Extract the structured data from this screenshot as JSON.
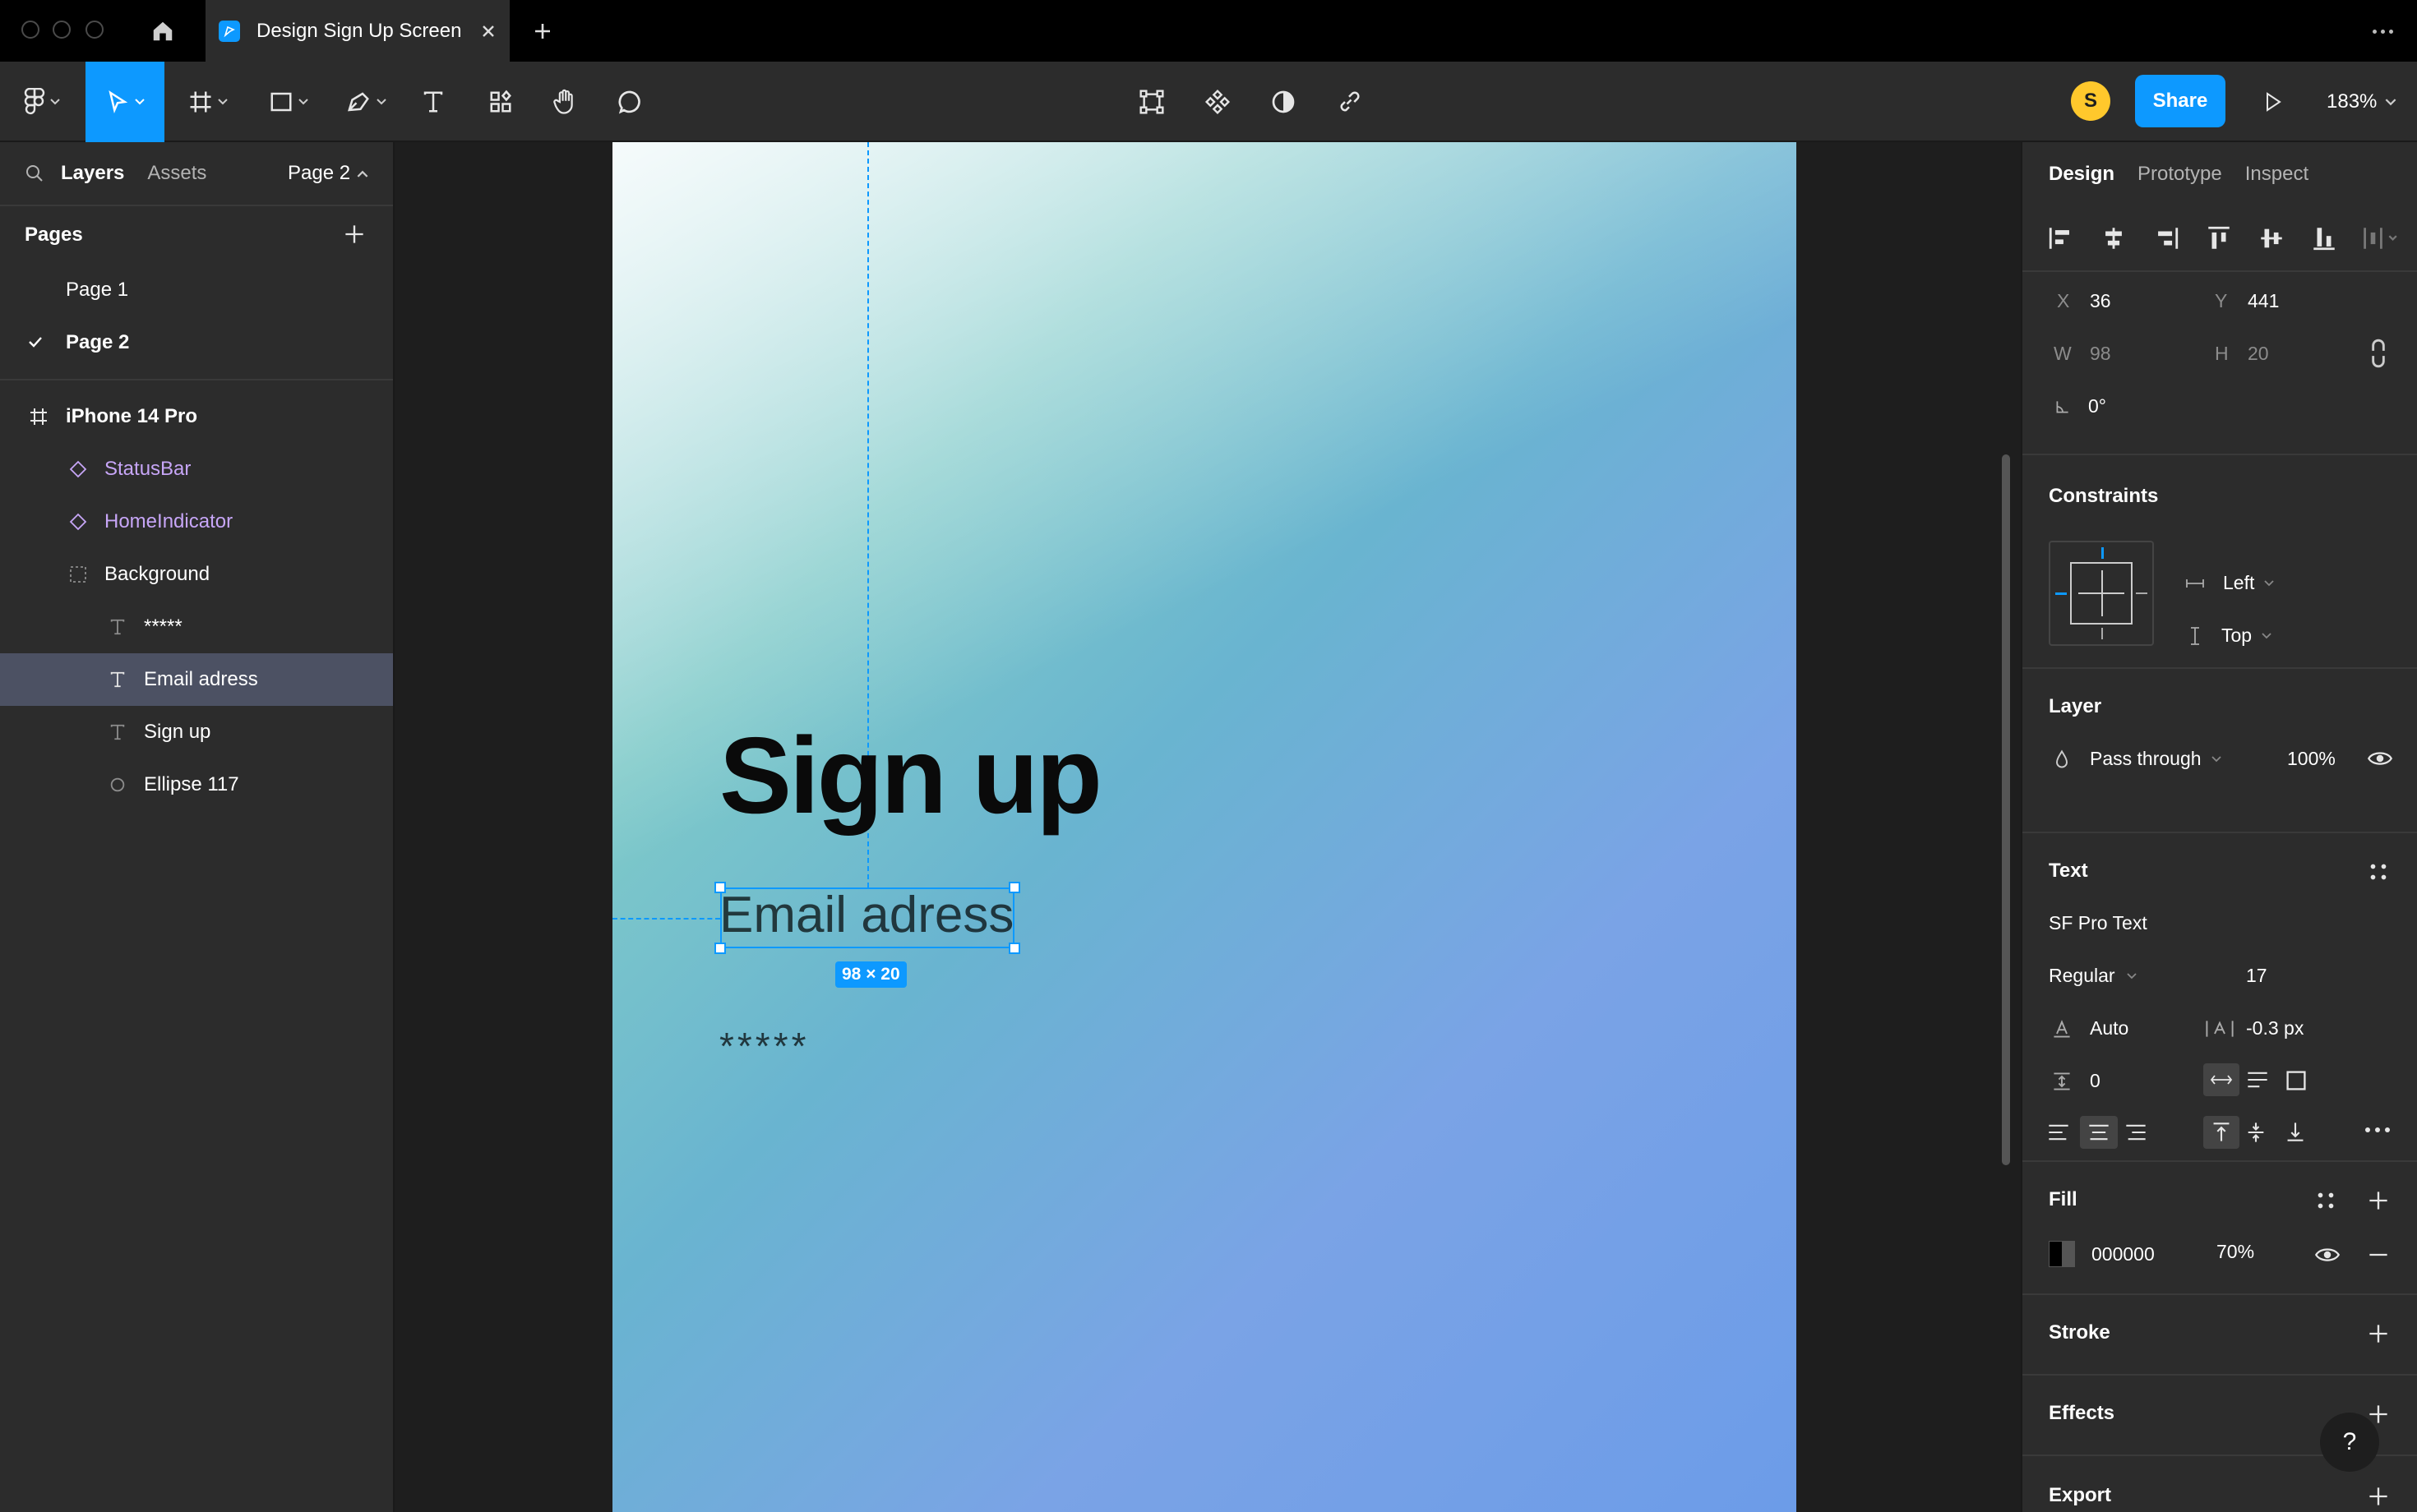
{
  "titlebar": {
    "tab_title": "Design Sign Up Screen",
    "home_icon": "home-icon",
    "new_tab_icon": "plus-icon"
  },
  "toolbar": {
    "avatar_initial": "S",
    "share_label": "Share",
    "zoom": "183%"
  },
  "left_panel": {
    "tabs": [
      "Layers",
      "Assets"
    ],
    "page_dropdown": "Page 2",
    "pages_title": "Pages",
    "pages": [
      {
        "label": "Page 1",
        "active": false
      },
      {
        "label": "Page 2",
        "active": true
      }
    ],
    "layers": [
      {
        "label": "iPhone 14 Pro",
        "icon": "frame-icon",
        "selected": false
      },
      {
        "label": "StatusBar",
        "icon": "component-instance-icon",
        "selected": false
      },
      {
        "label": "HomeIndicator",
        "icon": "component-instance-icon",
        "selected": false
      },
      {
        "label": "Background",
        "icon": "rectangle-icon",
        "selected": false
      },
      {
        "label": "*****",
        "icon": "text-icon",
        "selected": false
      },
      {
        "label": "Email adress",
        "icon": "text-icon",
        "selected": true
      },
      {
        "label": "Sign up",
        "icon": "text-icon",
        "selected": false
      },
      {
        "label": "Ellipse 117",
        "icon": "ellipse-icon",
        "selected": false
      }
    ]
  },
  "canvas": {
    "title": "Sign up",
    "email_text": "Email adress",
    "password_mask": "*****",
    "selection_size": "98 × 20"
  },
  "right_panel": {
    "tabs": [
      "Design",
      "Prototype",
      "Inspect"
    ],
    "position": {
      "x_label": "X",
      "x": "36",
      "y_label": "Y",
      "y": "441",
      "w_label": "W",
      "w": "98",
      "h_label": "H",
      "h": "20",
      "rotation": "0°"
    },
    "constraints": {
      "title": "Constraints",
      "horizontal": "Left",
      "vertical": "Top"
    },
    "layer": {
      "title": "Layer",
      "blend": "Pass through",
      "opacity": "100%"
    },
    "text": {
      "title": "Text",
      "font": "SF Pro Text",
      "weight": "Regular",
      "size": "17",
      "line_height": "Auto",
      "letter_spacing": "-0.3 px",
      "paragraph_spacing": "0"
    },
    "fill": {
      "title": "Fill",
      "hex": "000000",
      "opacity": "70%",
      "swatch_color": "#000000"
    },
    "stroke_title": "Stroke",
    "effects_title": "Effects",
    "export_title": "Export",
    "help": "?"
  },
  "colors": {
    "accent": "#0d99ff",
    "layer_purple": "#c7a6f7",
    "avatar": "#ffc82c"
  }
}
